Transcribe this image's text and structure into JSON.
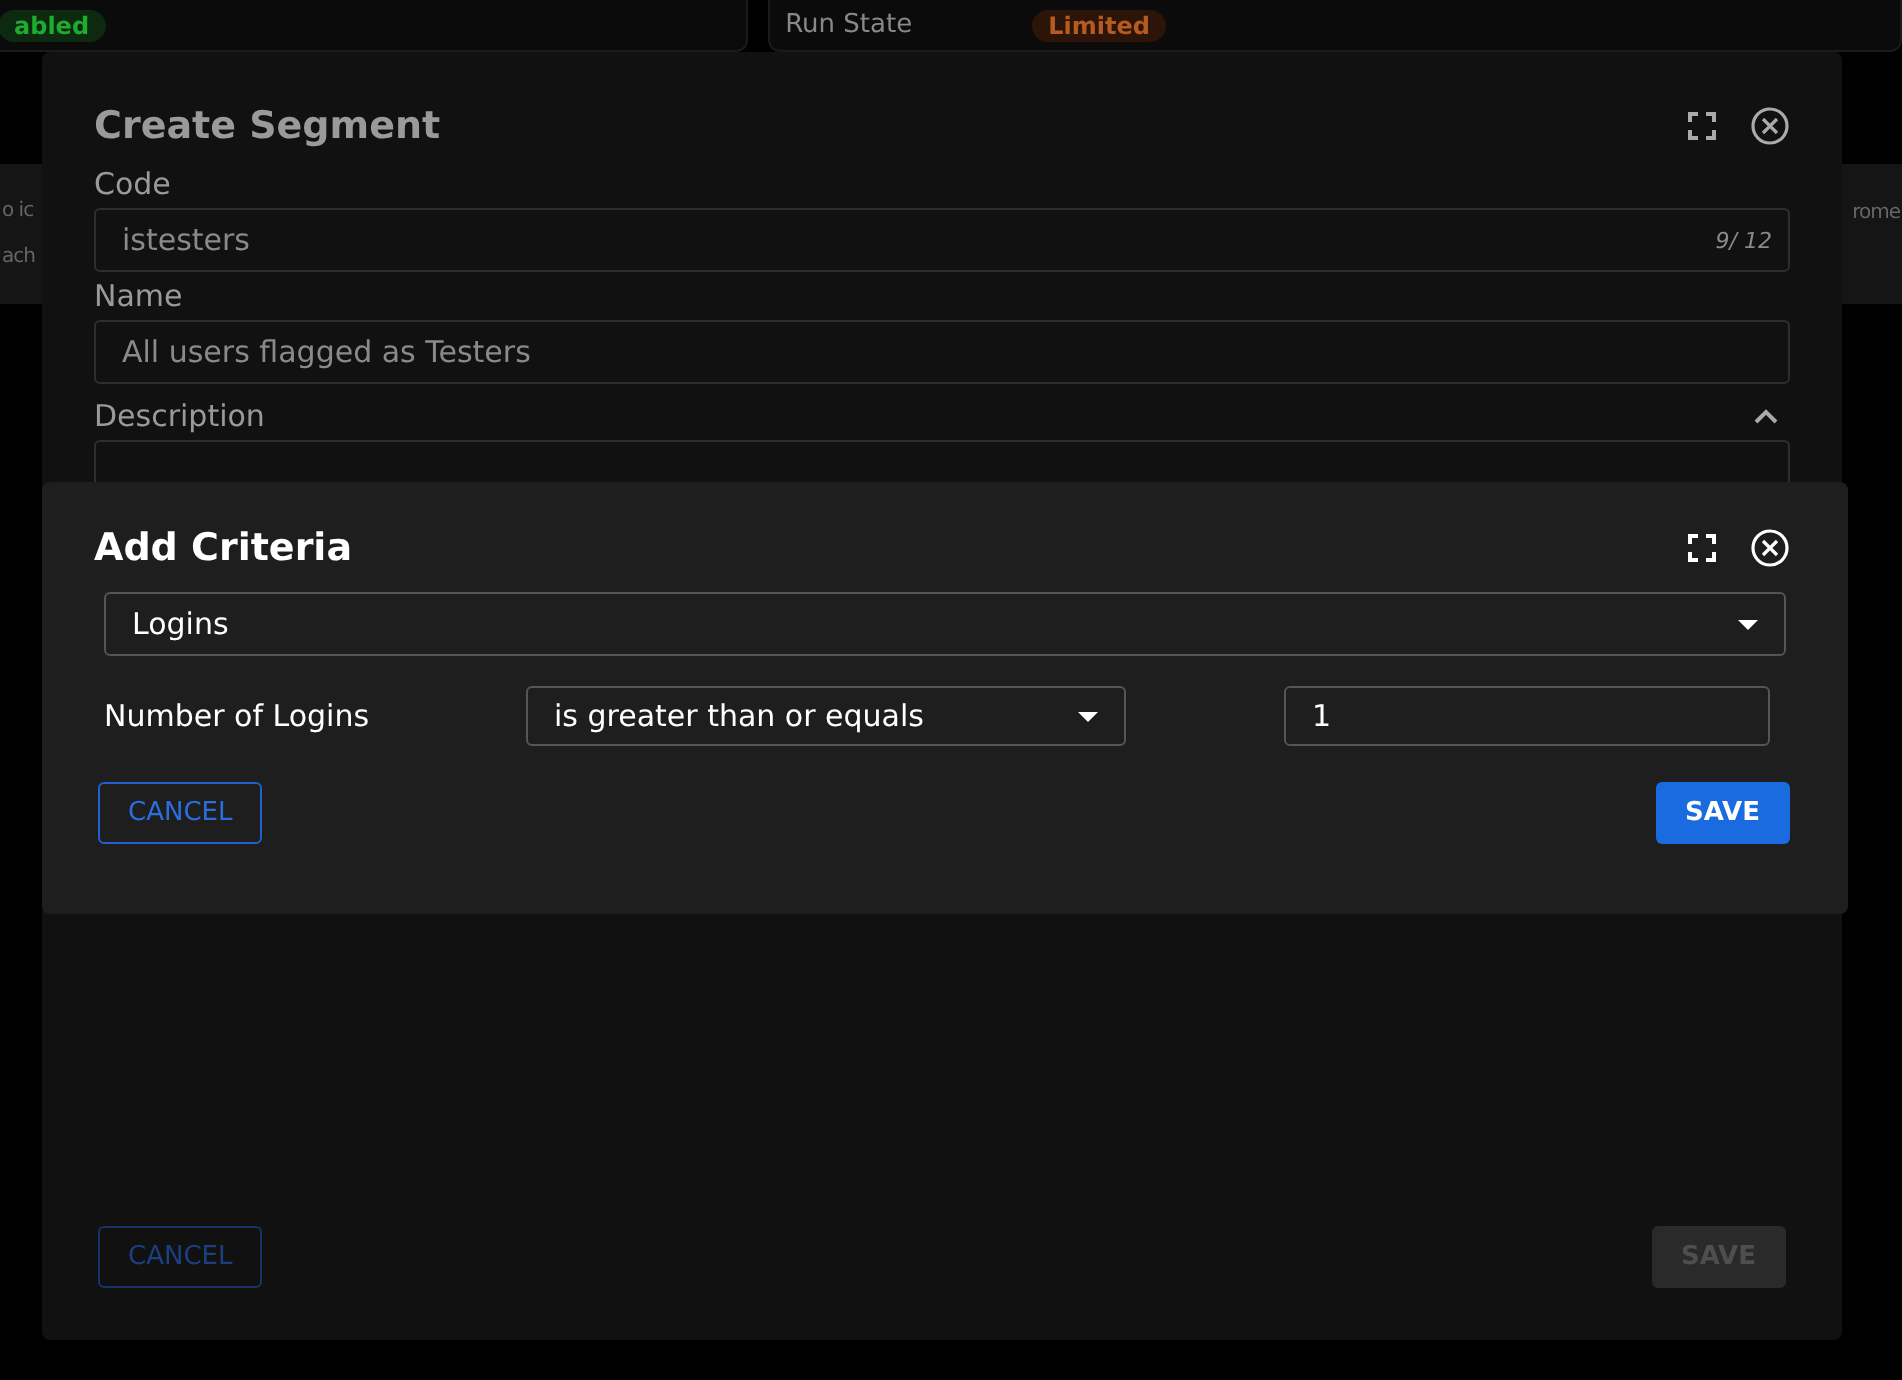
{
  "background": {
    "status_badge": "abled",
    "run_state_label": "Run State",
    "run_state_badge": "Limited",
    "banner_left_lines": [
      "o ic",
      "ach"
    ],
    "banner_right": "rome"
  },
  "create_segment": {
    "title": "Create Segment",
    "code": {
      "label": "Code",
      "value": "istesters",
      "counter": "9/ 12"
    },
    "name": {
      "label": "Name",
      "value": "All users flagged as Testers"
    },
    "description": {
      "label": "Description",
      "expanded": true
    },
    "cancel": "CANCEL",
    "save": {
      "label": "SAVE",
      "disabled": true
    }
  },
  "add_criteria": {
    "title": "Add Criteria",
    "criterion": "Logins",
    "condition": {
      "label": "Number of Logins",
      "operator": "is greater than or equals",
      "value": "1"
    },
    "cancel": "CANCEL",
    "save": {
      "label": "SAVE",
      "disabled": false
    }
  }
}
